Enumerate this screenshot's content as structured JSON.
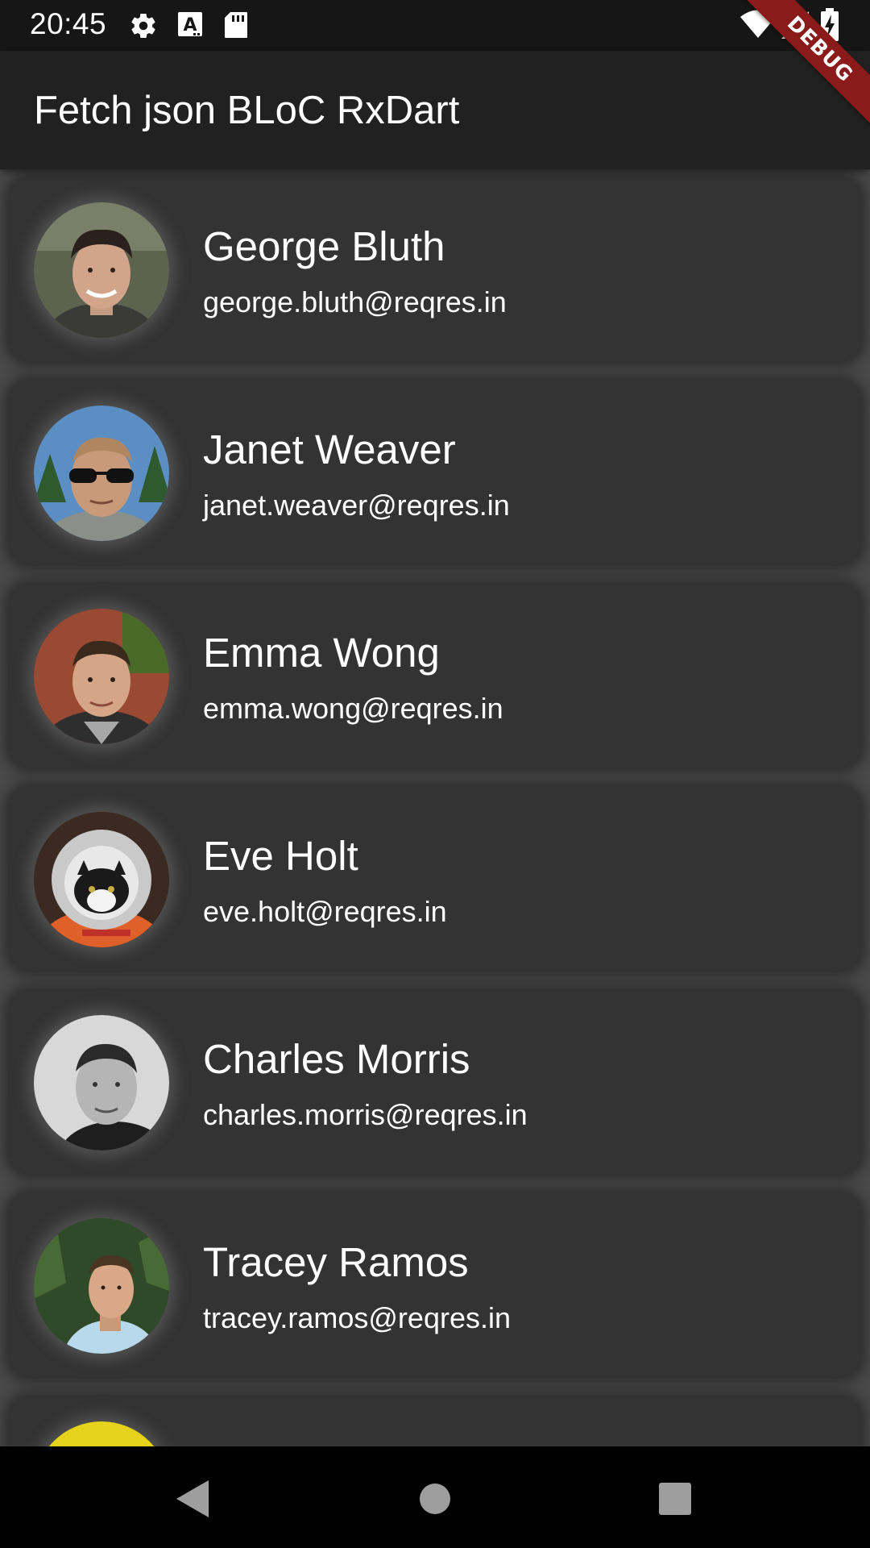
{
  "status_bar": {
    "time": "20:45",
    "icons_left": [
      "settings-icon",
      "text-a-icon",
      "sd-card-icon"
    ],
    "icons_right": [
      "wifi-icon",
      "signal-icon",
      "battery-charging-icon"
    ]
  },
  "app_bar": {
    "title": "Fetch json BLoC RxDart"
  },
  "debug_banner": {
    "label": "DEBUG",
    "color": "#8b1a1a"
  },
  "users": [
    {
      "name": "George Bluth",
      "email": "george.bluth@reqres.in"
    },
    {
      "name": "Janet Weaver",
      "email": "janet.weaver@reqres.in"
    },
    {
      "name": "Emma Wong",
      "email": "emma.wong@reqres.in"
    },
    {
      "name": "Eve Holt",
      "email": "eve.holt@reqres.in"
    },
    {
      "name": "Charles Morris",
      "email": "charles.morris@reqres.in"
    },
    {
      "name": "Tracey Ramos",
      "email": "tracey.ramos@reqres.in"
    }
  ],
  "nav_bar": {
    "buttons": [
      "back-icon",
      "home-icon",
      "recents-icon"
    ]
  },
  "colors": {
    "status_bar": "#161616",
    "app_bar": "#212121",
    "card": "#333333",
    "background": "#4a4a4a",
    "text": "#ffffff"
  }
}
